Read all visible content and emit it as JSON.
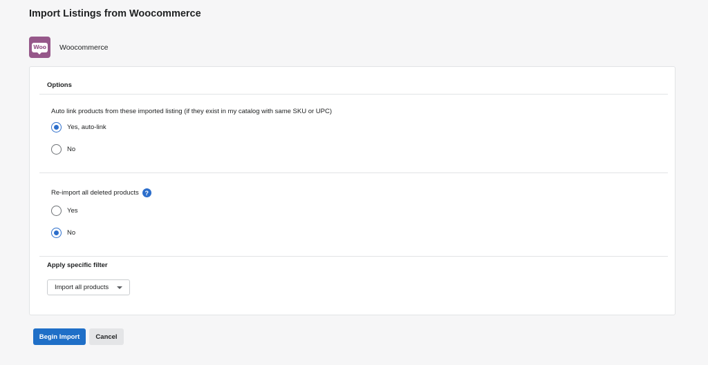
{
  "page": {
    "title": "Import Listings from Woocommerce"
  },
  "channel": {
    "logo_text": "Woo",
    "name": "Woocommerce",
    "logo_color": "#96588a"
  },
  "options": {
    "heading": "Options",
    "auto_link": {
      "question": "Auto link products from these imported listing (if they exist in my catalog with same SKU or UPC)",
      "choices": [
        {
          "label": "Yes, auto-link",
          "selected": true
        },
        {
          "label": "No",
          "selected": false
        }
      ]
    },
    "reimport": {
      "question": "Re-import all deleted products",
      "help_icon": "question-circle-icon",
      "help_glyph": "?",
      "choices": [
        {
          "label": "Yes",
          "selected": false
        },
        {
          "label": "No",
          "selected": true
        }
      ]
    }
  },
  "filter": {
    "heading": "Apply specific filter",
    "selected": "Import all products"
  },
  "actions": {
    "begin_label": "Begin Import",
    "cancel_label": "Cancel"
  },
  "colors": {
    "accent": "#2c6ecb",
    "primary_button": "#1f6fc7",
    "background": "#f6f6f7"
  }
}
